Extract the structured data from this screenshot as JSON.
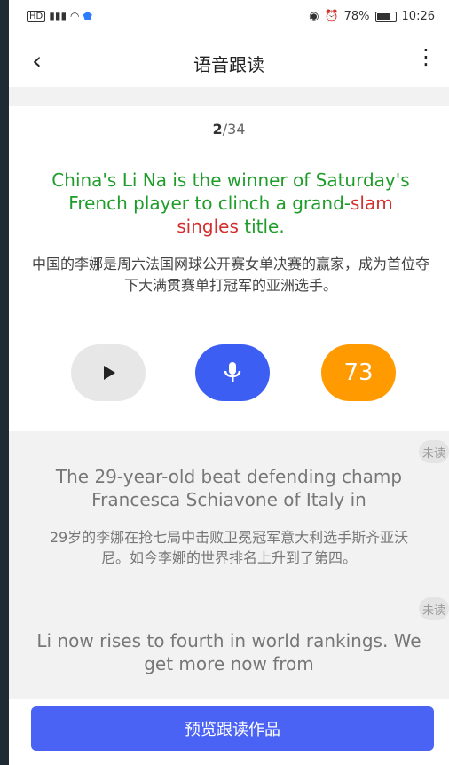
{
  "status": {
    "battery": "78%",
    "time": "10:26"
  },
  "header": {
    "title": "语音跟读"
  },
  "counter": {
    "current": "2",
    "separator": "/",
    "total": "34"
  },
  "sentence": {
    "parts": [
      {
        "text": "China's Li Na ",
        "color": "green"
      },
      {
        "text": "is the winner of Saturday's French player to clinch a grand-",
        "color": "green"
      },
      {
        "text": "slam singles",
        "color": "red"
      },
      {
        "text": " title.",
        "color": "green"
      }
    ],
    "translation": "中国的李娜是周六法国网球公开赛女单决赛的赢家，成为首位夺下大满贯赛单打冠军的亚洲选手。"
  },
  "controls": {
    "score": "73"
  },
  "items": [
    {
      "status": "未读",
      "en": "The 29-year-old beat defending champ Francesca Schiavone of Italy in",
      "zh": "29岁的李娜在抢七局中击败卫冕冠军意大利选手斯齐亚沃尼。如今李娜的世界排名上升到了第四。"
    },
    {
      "status": "未读",
      "en": "Li now rises to fourth in world rankings. We get more now from"
    }
  ],
  "bottom": {
    "preview_label": "预览跟读作品"
  }
}
